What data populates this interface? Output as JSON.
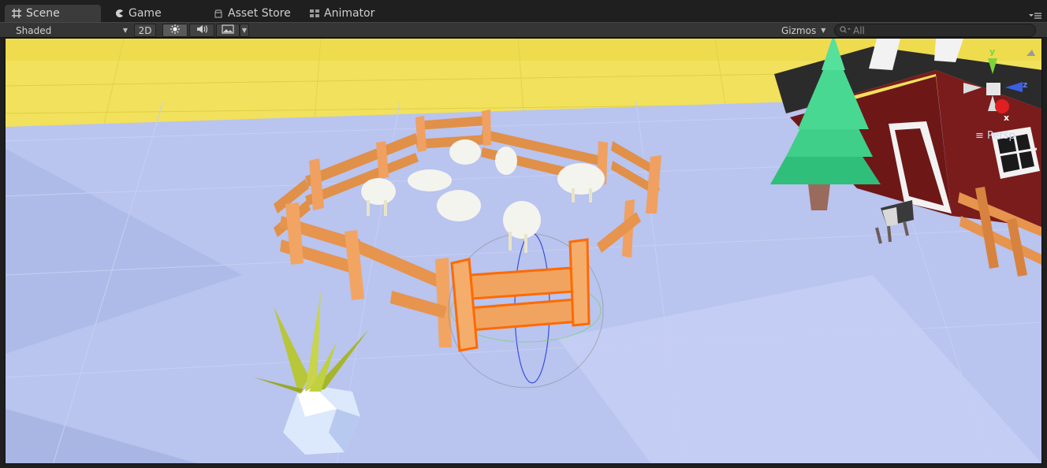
{
  "tabs": [
    {
      "label": "Scene",
      "icon": "grid-icon",
      "active": true
    },
    {
      "label": "Game",
      "icon": "pacman-icon",
      "active": false
    },
    {
      "label": "Asset Store",
      "icon": "store-icon",
      "active": false
    },
    {
      "label": "Animator",
      "icon": "animator-icon",
      "active": false
    }
  ],
  "toolbar": {
    "shading_mode": "Shaded",
    "mode_2d_label": "2D",
    "lighting_icon": "sun-icon",
    "audio_icon": "speaker-icon",
    "effects_icon": "image-icon",
    "gizmos_label": "Gizmos",
    "search_placeholder": "All"
  },
  "scene_gizmo": {
    "y_label": "y",
    "z_label": "z",
    "x_label": "x",
    "projection_label": "Persp"
  },
  "colors": {
    "sky": "#f0e05a",
    "ground": "#b7c3ee",
    "fence": "#e6944e",
    "selection": "#ff6a00",
    "barn": "#7a1c1c",
    "tree": "#3fcf88"
  }
}
